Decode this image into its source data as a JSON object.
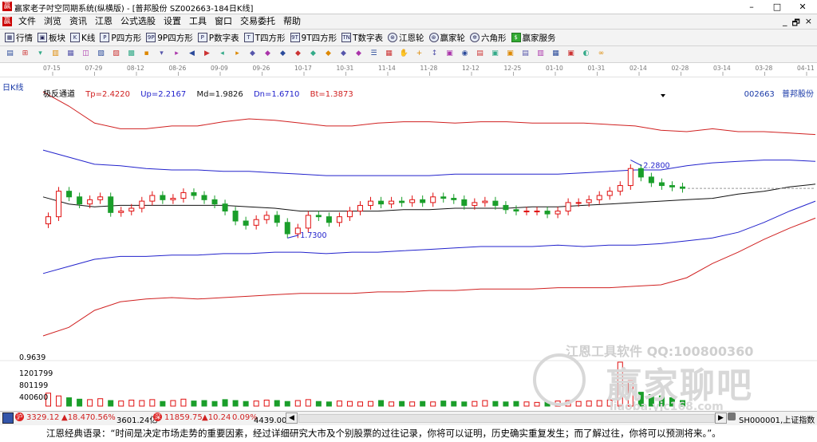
{
  "window": {
    "logo_glyph": "赢",
    "title": "赢家老子吋空同期系统(纵横版) - [普邦股份  SZ002663-184日K线]",
    "minimize_label": "–",
    "maximize_label": "□",
    "close_label": "✕"
  },
  "menubar": {
    "logo_glyph": "赢",
    "items": [
      "文件",
      "浏览",
      "资讯",
      "江恩",
      "公式选股",
      "设置",
      "工具",
      "窗口",
      "交易委托",
      "帮助"
    ],
    "mdi_minimize": "_",
    "mdi_restore": "🗗",
    "mdi_close": "×"
  },
  "toolbar1": {
    "items": [
      {
        "icon": "grid-icon",
        "glyph": "▦",
        "label": "行情"
      },
      {
        "icon": "blocks-icon",
        "glyph": "▣",
        "label": "板块"
      },
      {
        "icon": "k-line-icon",
        "glyph": "K",
        "label": "K线"
      },
      {
        "icon": "p-box-icon",
        "glyph": "P",
        "label": "P四方形"
      },
      {
        "icon": "9p-box-icon",
        "glyph": "9P",
        "label": "9P四方形"
      },
      {
        "icon": "p-numbers-icon",
        "glyph": "P",
        "label": "P数字表"
      },
      {
        "icon": "t-box-icon",
        "glyph": "T",
        "label": "T四方形"
      },
      {
        "icon": "9t-box-icon",
        "glyph": "9T",
        "label": "9T四方形"
      },
      {
        "icon": "t-numbers-icon",
        "glyph": "TN",
        "label": "T数字表"
      },
      {
        "icon": "gann-wheel-icon",
        "glyph": "⊛",
        "label": "江恩轮"
      },
      {
        "icon": "winner-wheel-icon",
        "glyph": "⊛",
        "label": "赢家轮"
      },
      {
        "icon": "hexagon-icon",
        "glyph": "✲",
        "label": "六角形"
      },
      {
        "icon": "service-icon",
        "glyph": "$",
        "label": "赢家服务"
      }
    ]
  },
  "toolbar2": {
    "icons": [
      "▤",
      "⊞",
      "▾",
      "▥",
      "▦",
      "◫",
      "▧",
      "▨",
      "▩",
      "▪",
      "▾",
      "▸",
      "◀",
      "▶",
      "◂",
      "▸",
      "◆",
      "◆",
      "◆",
      "◆",
      "◆",
      "◆",
      "◆",
      "◆",
      "☰",
      "▦",
      "✋",
      "+",
      "↕",
      "▣",
      "◉",
      "▤",
      "▣",
      "▣",
      "▤",
      "▥",
      "▦",
      "▣",
      "◐",
      "∞"
    ]
  },
  "timeline": {
    "period_label": "日K线",
    "dates": [
      "07-15",
      "07-29",
      "08-12",
      "08-26",
      "09-09",
      "09-26",
      "10-17",
      "10-31",
      "11-14",
      "11-28",
      "12-12",
      "12-25",
      "01-10",
      "01-31",
      "02-14",
      "02-28",
      "03-14",
      "03-28",
      "04-11"
    ]
  },
  "indicator": {
    "name": "极反通道",
    "tp": "Tp=2.4220",
    "up": "Up=2.2167",
    "md": "Md=1.9826",
    "dn": "Dn=1.6710",
    "bt": "Bt=1.3873",
    "stock_code": "002663",
    "stock_name": "普邦股份"
  },
  "chart_data": {
    "type": "candlestick",
    "title": "极反通道",
    "y_min_label": "0.9639",
    "annotations": [
      {
        "text": "2.2800",
        "kind": "high"
      },
      {
        "text": "1.7300",
        "kind": "low"
      }
    ],
    "volume_ticks": [
      "1201799",
      "801199",
      "400600"
    ],
    "series_colors": {
      "tp": "#d02020",
      "up": "#2222cc",
      "md": "#111111",
      "dn": "#2222cc",
      "bt": "#d02020",
      "up_candle": "#e01010",
      "down_candle": "#1a9e2a"
    },
    "price_ylim": [
      0.95,
      2.75
    ],
    "channel_samples": {
      "tp": [
        2.76,
        2.66,
        2.54,
        2.5,
        2.5,
        2.52,
        2.52,
        2.55,
        2.57,
        2.56,
        2.54,
        2.52,
        2.52,
        2.54,
        2.55,
        2.55,
        2.54,
        2.55,
        2.55,
        2.54,
        2.54,
        2.54,
        2.53,
        2.52,
        2.49,
        2.48,
        2.5,
        2.48,
        2.48,
        2.47,
        2.46
      ],
      "up": [
        2.35,
        2.3,
        2.25,
        2.24,
        2.22,
        2.21,
        2.21,
        2.2,
        2.2,
        2.19,
        2.18,
        2.17,
        2.17,
        2.17,
        2.17,
        2.17,
        2.18,
        2.18,
        2.18,
        2.18,
        2.18,
        2.19,
        2.2,
        2.21,
        2.21,
        2.24,
        2.26,
        2.27,
        2.28,
        2.28,
        2.27
      ],
      "md": [
        2.02,
        1.97,
        1.95,
        1.96,
        1.96,
        1.96,
        1.96,
        1.96,
        1.95,
        1.94,
        1.92,
        1.92,
        1.92,
        1.92,
        1.93,
        1.93,
        1.94,
        1.94,
        1.94,
        1.95,
        1.95,
        1.96,
        1.97,
        1.98,
        1.99,
        2.0,
        2.01,
        2.04,
        2.06,
        2.09,
        2.11
      ],
      "dn": [
        1.48,
        1.53,
        1.58,
        1.6,
        1.6,
        1.61,
        1.61,
        1.62,
        1.62,
        1.63,
        1.63,
        1.62,
        1.63,
        1.63,
        1.64,
        1.65,
        1.66,
        1.67,
        1.67,
        1.67,
        1.68,
        1.67,
        1.68,
        1.68,
        1.69,
        1.71,
        1.73,
        1.77,
        1.84,
        1.92,
        1.99
      ],
      "bt": [
        1.04,
        1.1,
        1.22,
        1.28,
        1.3,
        1.31,
        1.3,
        1.31,
        1.32,
        1.33,
        1.34,
        1.34,
        1.34,
        1.35,
        1.35,
        1.36,
        1.36,
        1.37,
        1.37,
        1.37,
        1.38,
        1.38,
        1.38,
        1.39,
        1.4,
        1.45,
        1.55,
        1.63,
        1.72,
        1.8,
        1.87
      ]
    },
    "candle_closes": [
      1.88,
      2.06,
      2.02,
      1.97,
      2.0,
      2.02,
      1.91,
      1.92,
      1.94,
      1.99,
      2.03,
      2.0,
      2.01,
      2.05,
      2.03,
      2.0,
      1.97,
      1.92,
      1.85,
      1.82,
      1.86,
      1.89,
      1.84,
      1.76,
      1.8,
      1.89,
      1.88,
      1.84,
      1.88,
      1.92,
      1.96,
      1.99,
      1.97,
      1.99,
      1.98,
      2.0,
      1.98,
      2.02,
      2.01,
      2.0,
      1.96,
      1.98,
      1.99,
      1.96,
      1.93,
      1.92,
      1.92,
      1.92,
      1.9,
      1.92,
      1.98,
      1.98,
      2.0,
      2.03,
      2.06,
      2.1,
      2.22,
      2.16,
      2.12,
      2.1,
      2.09,
      2.08
    ],
    "volumes": [
      0.28,
      0.22,
      0.18,
      0.15,
      0.14,
      0.16,
      0.12,
      0.11,
      0.13,
      0.12,
      0.14,
      0.1,
      0.12,
      0.15,
      0.11,
      0.12,
      0.1,
      0.14,
      0.12,
      0.1,
      0.11,
      0.13,
      0.12,
      0.1,
      0.12,
      0.14,
      0.1,
      0.09,
      0.11,
      0.1,
      0.09,
      0.1,
      0.12,
      0.09,
      0.1,
      0.09,
      0.1,
      0.09,
      0.11,
      0.1,
      0.09,
      0.1,
      0.12,
      0.1,
      0.09,
      0.1,
      0.09,
      0.08,
      0.1,
      0.11,
      0.12,
      0.1,
      0.11,
      0.12,
      0.13,
      0.95,
      0.55,
      0.3,
      0.25,
      0.22,
      0.18,
      0.12
    ]
  },
  "watermark": {
    "line1": "江恩工具软件  QQ:100800360",
    "line2": "赢家聊吧",
    "line3": "liaoba.yjc168.com"
  },
  "statusbar": {
    "sh_index": "3329.12",
    "sh_change": "▲18.47",
    "sh_pct": "0.56%",
    "sh_amount": "3601.24亿",
    "sz_index": "11859.75",
    "sz_change": "▲10.24",
    "sz_pct": "0.09%",
    "sz_amount": "4439.00亿",
    "right_code": "SH000001,上证指数"
  },
  "quote": {
    "text": "江恩经典语录：“时间是决定市场走势的重要因素，经过详细研究大市及个别股票的过往记录，你将可以证明，历史确实重复发生；而了解过往，你将可以预测将来。”。"
  }
}
